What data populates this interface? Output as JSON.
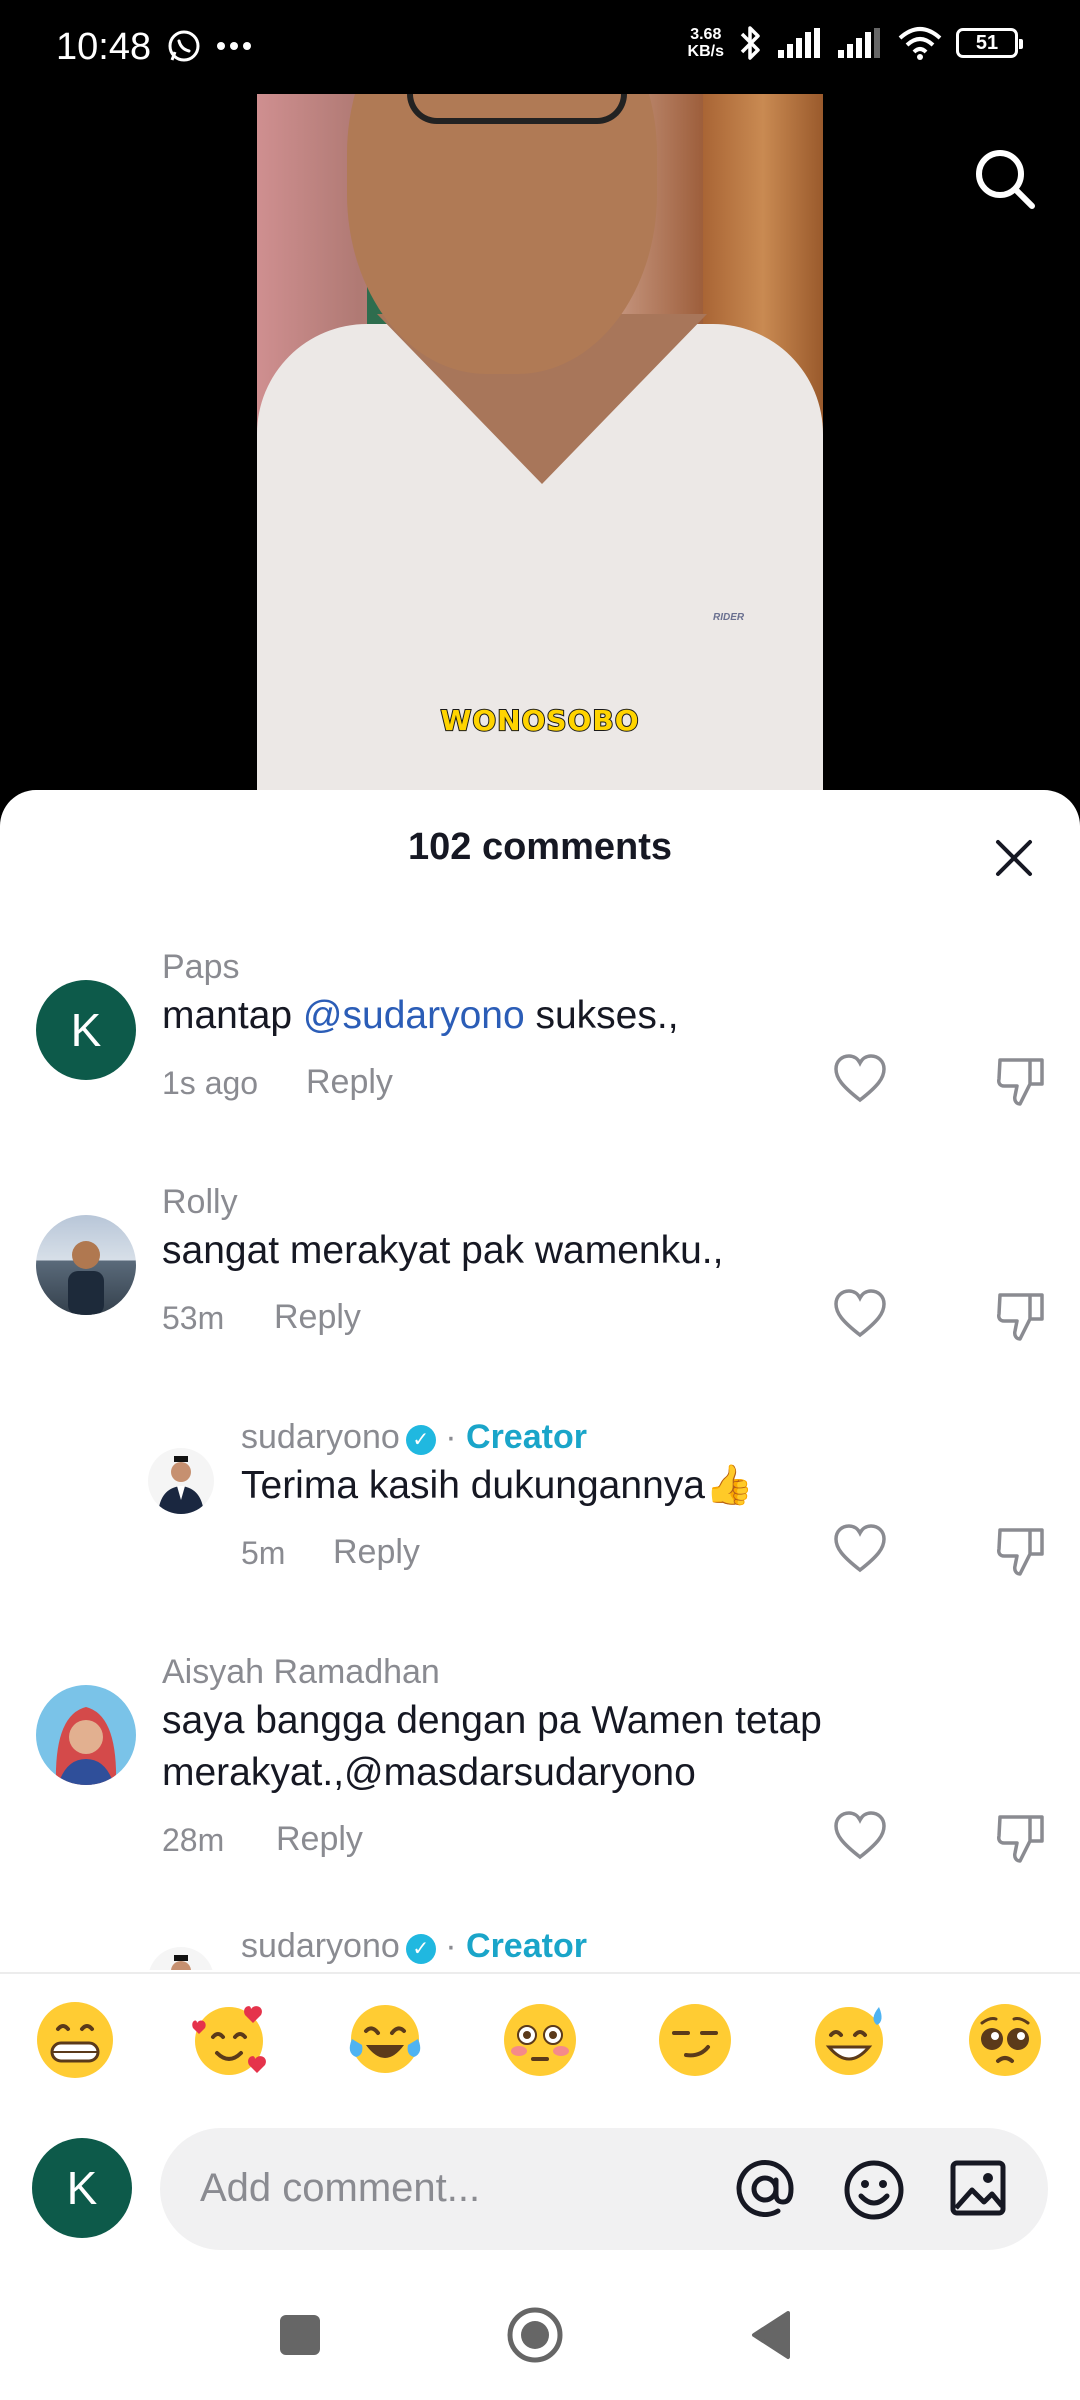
{
  "status_bar": {
    "time": "10:48",
    "net_speed_value": "3.68",
    "net_speed_unit": "KB/s",
    "battery": "51"
  },
  "video": {
    "caption": "WONOSOBO",
    "shirt_brand": "RIDER"
  },
  "comments_sheet": {
    "title": "102 comments",
    "comments": [
      {
        "avatar_letter": "K",
        "name": "Paps",
        "text_before": "mantap ",
        "mention": "@sudaryono",
        "text_after": " sukses.,",
        "time": "1s ago",
        "reply": "Reply"
      },
      {
        "name": "Rolly",
        "text": "sangat merakyat pak wamenku.,",
        "time": "53m",
        "reply": "Reply"
      },
      {
        "name": "sudaryono",
        "separator": "·",
        "badge": "Creator",
        "text": "Terima kasih dukungannya👍",
        "time": "5m",
        "reply": "Reply",
        "is_reply": true
      },
      {
        "name": "Aisyah Ramadhan",
        "text_line1": "saya bangga dengan pa Wamen tetap",
        "text_line2": "merakyat.,@masdarsudaryono",
        "time": "28m",
        "reply": "Reply"
      },
      {
        "name": "sudaryono",
        "separator": "·",
        "badge": "Creator",
        "is_reply": true
      }
    ]
  },
  "emoji_bar": [
    "grinning-face",
    "smiling-face-with-hearts",
    "face-with-tears-of-joy",
    "flushed-face",
    "smirking-face",
    "grinning-face-with-sweat",
    "pleading-face"
  ],
  "input": {
    "avatar_letter": "K",
    "placeholder": "Add comment..."
  },
  "colors": {
    "accent_mention": "#2b5db7",
    "creator": "#1aa5c9",
    "avatar_bg": "#0d5a4a"
  }
}
